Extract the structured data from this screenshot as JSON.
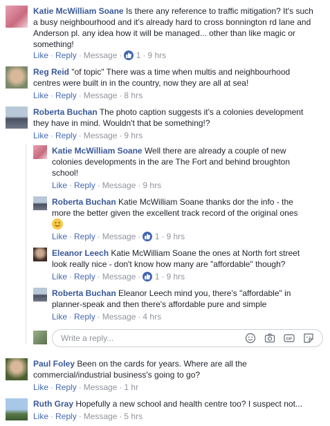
{
  "comments": [
    {
      "name": "Katie McWilliam Soane",
      "lines": [
        "Is there any reference to traffic mitigation? It's such",
        "a busy neighbourhood and it's already hard to cross bonnington rd lane and",
        "Anderson pl. any idea how it will be managed... other than like magic or",
        "something!"
      ],
      "like": "Like",
      "reply": "Reply",
      "message": "Message",
      "reactions": "1",
      "time": "9 hrs"
    },
    {
      "name": "Reg Reid",
      "lines": [
        "\"of topic\" There was a time when multis and neighbourhood",
        "centres were built in in the country, now they are all at sea!"
      ],
      "like": "Like",
      "reply": "Reply",
      "message": "Message",
      "time": "8 hrs"
    },
    {
      "name": "Roberta Buchan",
      "lines": [
        "The photo caption suggests it's a colonies development",
        "they have in mind. Wouldn't that be something!?"
      ],
      "like": "Like",
      "reply": "Reply",
      "message": "Message",
      "time": "9 hrs"
    }
  ],
  "replies": [
    {
      "name": "Katie McWilliam Soane",
      "lines": [
        "Well there are already a couple of new",
        "colonies developments in the are The Fort and behind broughton",
        "school!"
      ],
      "like": "Like",
      "reply": "Reply",
      "message": "Message",
      "time": "9 hrs"
    },
    {
      "name": "Roberta Buchan",
      "lines": [
        "Katie McWilliam Soane thanks dor the info - the",
        "more the better given the excellent track record of the original ones"
      ],
      "like": "Like",
      "reply": "Reply",
      "message": "Message",
      "reactions": "1",
      "time": "9 hrs"
    },
    {
      "name": "Eleanor Leech",
      "lines": [
        "Katie McWilliam Soane the ones at North fort street",
        "look really nice - don't know how many are \"affordable\" though?"
      ],
      "like": "Like",
      "reply": "Reply",
      "message": "Message",
      "reactions": "1",
      "time": "9 hrs"
    },
    {
      "name": "Roberta Buchan",
      "lines": [
        "Eleanor Leech mind you, there's \"affordable\" in",
        "planner-speak and then there's affordable pure and simple"
      ],
      "like": "Like",
      "reply": "Reply",
      "message": "Message",
      "time": "4 hrs"
    }
  ],
  "reply_box": {
    "placeholder": "Write a reply..."
  },
  "bottom": [
    {
      "name": "Paul Foley",
      "lines": [
        "Been on the cards for years. Where are all the",
        "commercial/industrial business's going to go?"
      ],
      "like": "Like",
      "reply": "Reply",
      "message": "Message",
      "time": "1 hr"
    },
    {
      "name": "Ruth Gray",
      "lines": [
        "Hopefully a new school and health centre too? I suspect not..."
      ],
      "like": "Like",
      "reply": "Reply",
      "message": "Message",
      "time": "5 hrs"
    }
  ],
  "colors": {
    "link": "#385898",
    "action": "#4267b2",
    "meta": "#90949c",
    "like_badge": "#4267b2"
  }
}
